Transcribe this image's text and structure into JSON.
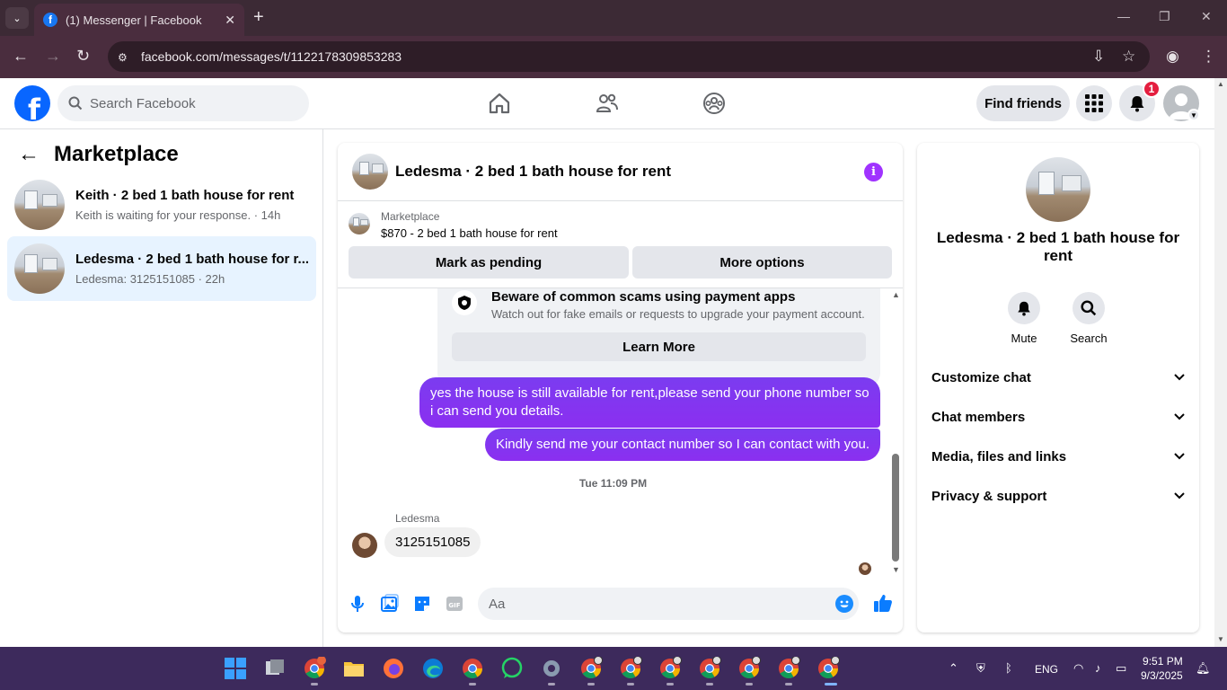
{
  "browser": {
    "tab_title": "(1) Messenger | Facebook",
    "url": "facebook.com/messages/t/1122178309853283"
  },
  "fb": {
    "search_placeholder": "Search Facebook",
    "find_friends": "Find friends",
    "notification_count": "1"
  },
  "left": {
    "title": "Marketplace",
    "chats": [
      {
        "name": "Keith · 2 bed 1 bath house for rent",
        "sub": "Keith is waiting for your response. · 14h"
      },
      {
        "name": "Ledesma · 2 bed 1 bath house for r...",
        "sub": "Ledesma: 3125151085 · 22h"
      }
    ]
  },
  "convo": {
    "title": "Ledesma · 2 bed 1 bath house for rent",
    "mp_label": "Marketplace",
    "mp_item": "$870 - 2 bed 1 bath house for rent",
    "mark_pending": "Mark as pending",
    "more_options": "More options",
    "scam_title": "Beware of common scams using payment apps",
    "scam_desc": "Watch out for fake emails or requests to upgrade your payment account.",
    "learn_more": "Learn More",
    "out_messages": [
      "yes the house is still available for rent,please send your phone number so i can send you details.",
      "Kindly send me your contact number so I can contact with you."
    ],
    "timestamp": "Tue 11:09 PM",
    "sender": "Ledesma",
    "in_message": "3125151085",
    "input_placeholder": "Aa"
  },
  "right": {
    "name": "Ledesma · 2 bed 1 bath house for rent",
    "mute": "Mute",
    "search": "Search",
    "sections": [
      "Customize chat",
      "Chat members",
      "Media, files and links",
      "Privacy & support"
    ]
  },
  "taskbar": {
    "lang": "ENG",
    "time": "9:51 PM",
    "date": "9/3/2025"
  },
  "colors": {
    "fb_blue": "#0866ff",
    "outgoing_bubble": "#7b3cf0",
    "active_chat_bg": "#e7f3ff",
    "badge_red": "#e41e3f"
  }
}
